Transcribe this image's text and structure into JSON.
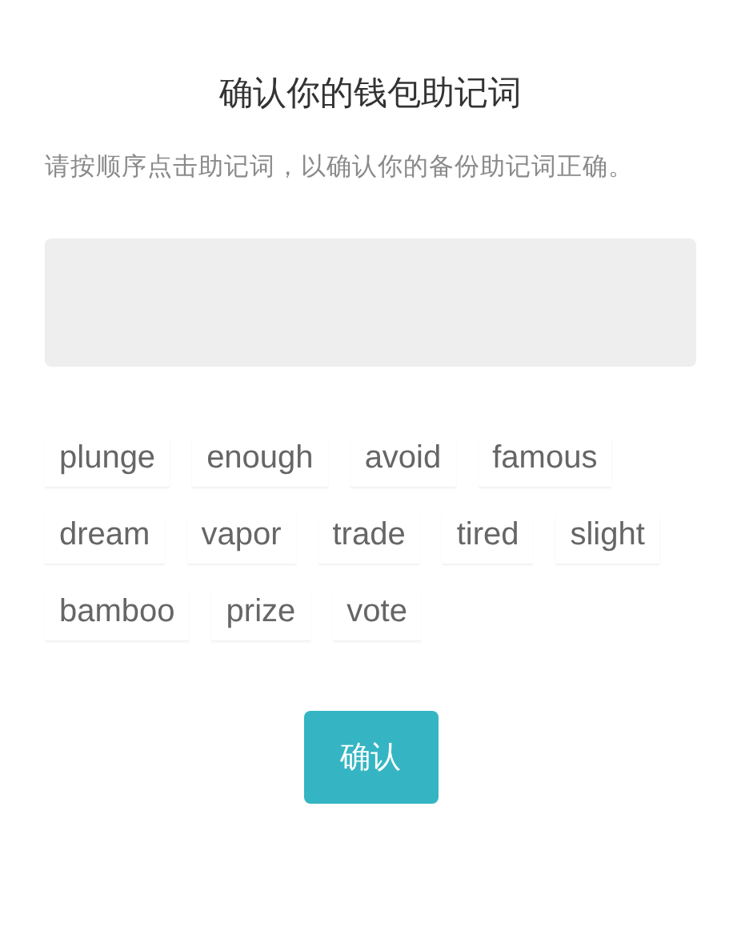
{
  "title": "确认你的钱包助记词",
  "instruction": "请按顺序点击助记词，以确认你的备份助记词正确。",
  "words": [
    "plunge",
    "enough",
    "avoid",
    "famous",
    "dream",
    "vapor",
    "trade",
    "tired",
    "slight",
    "bamboo",
    "prize",
    "vote"
  ],
  "confirm_button": "确认"
}
